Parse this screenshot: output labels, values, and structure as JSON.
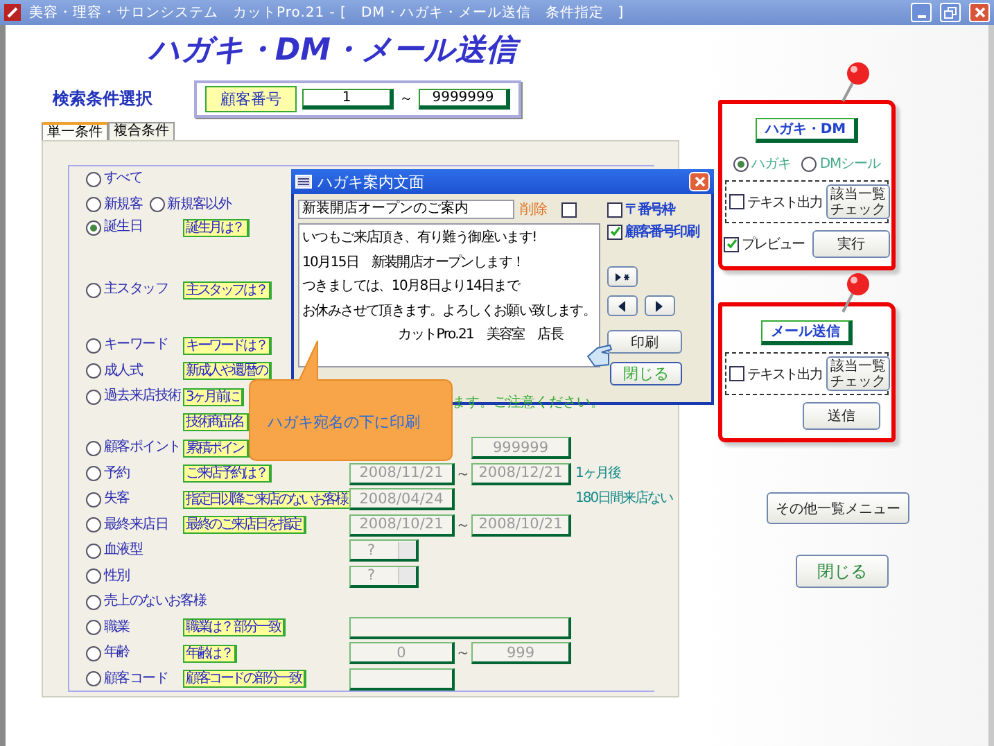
{
  "window": {
    "title": "美容・理容・サロンシステム　カットPro.21 - [　DM・ハガキ・メール送信　条件指定　]"
  },
  "heading": "ハガキ・DM・メール送信",
  "search": {
    "label": "検索条件選択",
    "field_label": "顧客番号",
    "from": "1",
    "separator": "～",
    "to": "9999999"
  },
  "tabs": [
    {
      "label": "単一条件",
      "selected": true
    },
    {
      "label": "複合条件",
      "selected": false
    }
  ],
  "conditions": [
    {
      "options": [
        {
          "label": "すべて",
          "selected": false
        }
      ]
    },
    {
      "options": [
        {
          "label": "新規客",
          "selected": false
        },
        {
          "label": "新規客以外",
          "selected": false
        }
      ]
    },
    {
      "options": [
        {
          "label": "誕生日",
          "selected": true
        }
      ],
      "hint": "誕生月は？",
      "kind": "tall"
    },
    {
      "options": [
        {
          "label": "主スタッフ",
          "selected": false
        }
      ],
      "hint": "主スタッフは？",
      "kind": "tall"
    },
    {
      "options": [
        {
          "label": "キーワード",
          "selected": false
        }
      ],
      "hint": "キーワードは？"
    },
    {
      "options": [
        {
          "label": "成人式",
          "selected": false
        }
      ],
      "hint": "新成人や還暦の"
    },
    {
      "options": [
        {
          "label": "過去来店技術",
          "selected": false
        }
      ],
      "hint": "3ヶ月前に"
    },
    {
      "hint": "技術商品名"
    },
    {
      "options": [
        {
          "label": "顧客ポイント",
          "selected": false
        }
      ],
      "hint": "累積ポイン",
      "fields": [
        {
          "kind": "to",
          "value": "999999"
        }
      ]
    },
    {
      "options": [
        {
          "label": "予約",
          "selected": false
        }
      ],
      "hint": "ご来店予約は？",
      "fields": [
        {
          "kind": "from",
          "value": "2008/11/21"
        },
        {
          "kind": "to",
          "value": "2008/12/21"
        }
      ],
      "separator": "～",
      "note": "1ヶ月後"
    },
    {
      "options": [
        {
          "label": "失客",
          "selected": false
        }
      ],
      "hint": "指定日以降ご来店のないお客様",
      "fields": [
        {
          "kind": "from",
          "value": "2008/04/24"
        }
      ],
      "note": "180日間来店ない"
    },
    {
      "options": [
        {
          "label": "最終来店日",
          "selected": false
        }
      ],
      "hint": "最終のご来店日を指定",
      "fields": [
        {
          "kind": "from",
          "value": "2008/10/21"
        },
        {
          "kind": "to",
          "value": "2008/10/21"
        }
      ],
      "separator": "～"
    },
    {
      "options": [
        {
          "label": "血液型",
          "selected": false
        }
      ],
      "fields": [
        {
          "kind": "dropdown",
          "value": "?"
        }
      ]
    },
    {
      "options": [
        {
          "label": "性別",
          "selected": false
        }
      ],
      "fields": [
        {
          "kind": "dropdown",
          "value": "?"
        }
      ]
    },
    {
      "options": [
        {
          "label": "売上のないお客様",
          "selected": false
        }
      ]
    },
    {
      "options": [
        {
          "label": "職業",
          "selected": false
        }
      ],
      "hint": "職業は？ 部分一致",
      "fields": [
        {
          "kind": "wide"
        }
      ]
    },
    {
      "options": [
        {
          "label": "年齢",
          "selected": false
        }
      ],
      "hint": "年齢は？",
      "fields": [
        {
          "kind": "from",
          "value": "0"
        },
        {
          "kind": "to",
          "value": "999"
        }
      ],
      "separator": "～"
    },
    {
      "options": [
        {
          "label": "顧客コード",
          "selected": false
        }
      ],
      "hint": "顧客コードの部分一致",
      "fields": [
        {
          "kind": "from"
        }
      ]
    }
  ],
  "dialog": {
    "title": "ハガキ案内文面",
    "subject": "新装開店オープンのご案内",
    "delete_label": "削除",
    "delete_checked": false,
    "checkboxes": [
      {
        "label": "〒番号枠",
        "checked": false
      },
      {
        "label": "顧客番号印刷",
        "checked": true
      }
    ],
    "lines": [
      {
        "text": "いつもご来店頂き、有り難う御座います!",
        "kind": "body"
      },
      {
        "text": "10月15日　新装開店オープンします！",
        "kind": "body"
      },
      {
        "text": "つきましては、10月8日より14日まで",
        "kind": "body"
      },
      {
        "text": "お休みさせて頂きます。よろしくお願い致します。",
        "kind": "body"
      },
      {
        "text": "カットPro.21　美容室　店長",
        "kind": "signature"
      }
    ],
    "print_button": "印刷",
    "close_button": "閉じる",
    "warning": "ます。ご注意ください。"
  },
  "callout": "ハガキ宛名の下に印刷",
  "cards": [
    {
      "title": "ハガキ・DM",
      "radios": [
        {
          "label": "ハガキ",
          "selected": true
        },
        {
          "label": "DMシール",
          "selected": false
        }
      ],
      "text_output": {
        "label": "テキスト出力",
        "checked": false
      },
      "check_button": "該当一覧チェック",
      "preview": {
        "label": "プレビュー",
        "checked": true
      },
      "action_button": "実行"
    },
    {
      "title": "メール送信",
      "text_output": {
        "label": "テキスト出力",
        "checked": false
      },
      "check_button": "該当一覧チェック",
      "action_button": "送信"
    }
  ],
  "menu_button": "その他一覧メニュー",
  "close_button": "閉じる"
}
